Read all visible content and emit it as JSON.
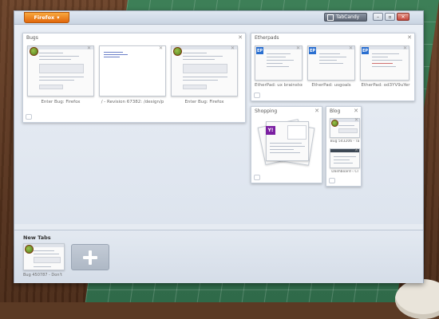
{
  "titlebar": {
    "app_button_label": "Firefox",
    "app_button_arrow": "▾",
    "tabcandy_label": "TabCandy",
    "minimize_glyph": "–",
    "maximize_glyph": "▫",
    "close_glyph": "✕"
  },
  "groups": {
    "bugs": {
      "title": "Bugs",
      "tabs": [
        {
          "label": "Enter Bug: Firefox",
          "favicon": "bug-icon"
        },
        {
          "label": "/ - Revision 67382: /design/p",
          "favicon": ""
        },
        {
          "label": "Enter Bug: Firefox",
          "favicon": "bug-icon"
        }
      ]
    },
    "etherpads": {
      "title": "Etherpads",
      "tabs": [
        {
          "label": "EtherPad: ux brainstorm",
          "favicon": "EP"
        },
        {
          "label": "EtherPad: usgoals",
          "favicon": "EP"
        },
        {
          "label": "EtherPad: od3YV9uYer",
          "favicon": "EP"
        }
      ]
    },
    "shopping": {
      "title": "Shopping",
      "favicon": "Y!"
    },
    "blog": {
      "title": "Blog",
      "tabs": [
        {
          "label": "Bug 543206 - Ta"
        },
        {
          "label": "Dashboard ‹ Cl"
        }
      ]
    }
  },
  "tray": {
    "title": "New Tabs",
    "tabs": [
      {
        "label": "Bug 450787 - Don't"
      }
    ]
  },
  "close_glyph": "✕",
  "colors": {
    "firefox_orange": "#e2670c",
    "workspace_bg": "#e6ebf2",
    "etherpad_blue": "#2a6fd0",
    "yahoo_purple": "#7b1fa2"
  }
}
